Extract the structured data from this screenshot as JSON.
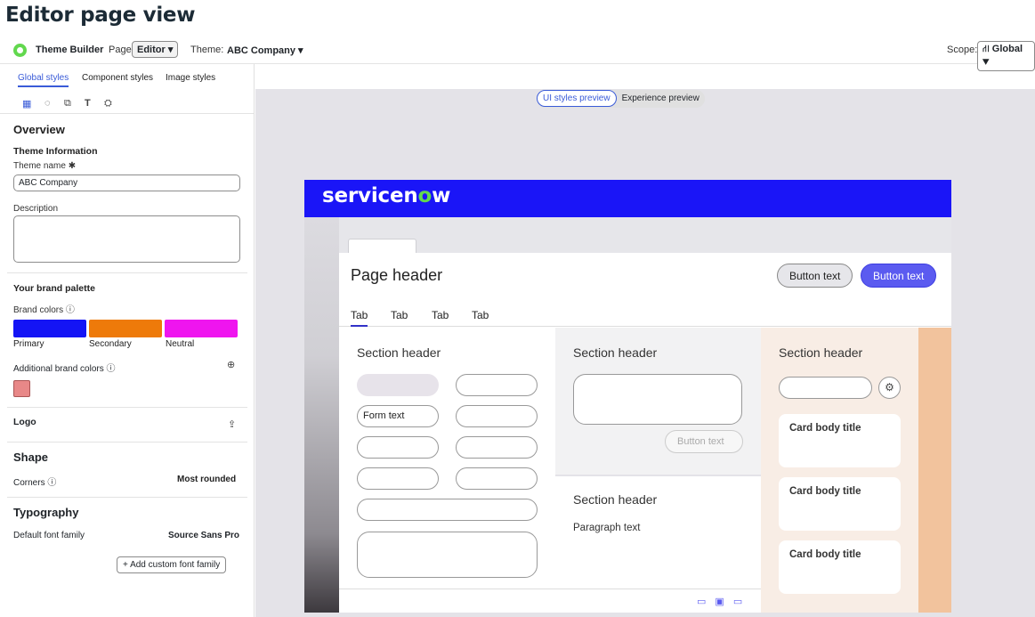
{
  "doc_title": "Editor page view",
  "appbar": {
    "app_name": "Theme Builder",
    "page_label": "Page:",
    "page_value": "Editor ▾",
    "theme_label": "Theme:",
    "theme_value": "ABC Company ▾",
    "scope_label": "Scope:",
    "scope_value": "⛙ Global ▾"
  },
  "left_tabs": [
    "Global styles",
    "Component styles",
    "Image styles"
  ],
  "icons": [
    "▦",
    "◌",
    "⧉",
    "T",
    "⛭"
  ],
  "overview": {
    "title": "Overview",
    "theme_info": "Theme Information",
    "theme_name_label": "Theme name ✱",
    "theme_name_value": "ABC Company",
    "description_label": "Description"
  },
  "brand": {
    "title": "Your brand palette",
    "colors_label": "Brand colors ⓘ",
    "primary": "Primary",
    "secondary": "Secondary",
    "neutral": "Neutral",
    "primary_color": "#1414f5",
    "secondary_color": "#ee7a0a",
    "neutral_color": "#ef15ef",
    "additional_label": "Additional brand colors ⓘ",
    "additional_color": "#e88888",
    "add_icon": "⊕"
  },
  "logo": {
    "label": "Logo",
    "upload_icon": "⇪"
  },
  "shape": {
    "title": "Shape",
    "corners_label": "Corners ⓘ",
    "corners_value": "Most rounded"
  },
  "typography": {
    "title": "Typography",
    "default_label": "Default font family",
    "default_value": "Source Sans Pro",
    "add_button": "+ Add custom font family"
  },
  "preview": {
    "ui_label": "UI styles preview",
    "exp_label": "Experience preview",
    "logo_text_a": "servicen",
    "logo_text_o": "o",
    "logo_text_b": "w",
    "page_header": "Page header",
    "button_secondary": "Button text",
    "button_primary": "Button text",
    "tabs": [
      "Tab",
      "Tab",
      "Tab",
      "Tab"
    ],
    "section_header": "Section header",
    "form_text": "Form text",
    "button_disabled": "Button text",
    "paragraph": "Paragraph text",
    "card_title": "Card body title",
    "filter_icon": "⚙",
    "bottom_icons": [
      "▭",
      "▣",
      "▭"
    ]
  }
}
